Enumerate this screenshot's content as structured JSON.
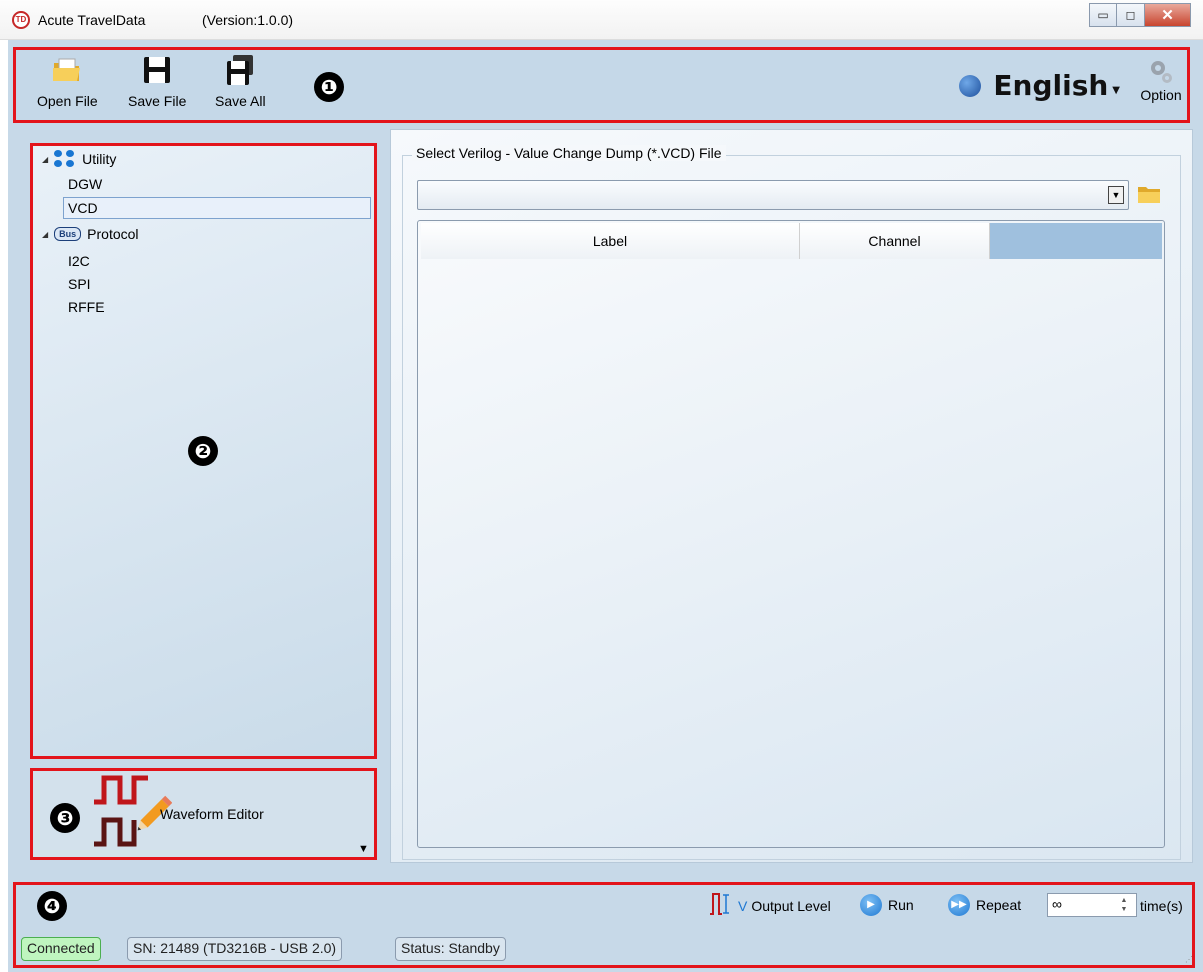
{
  "window": {
    "app_icon": "TD",
    "title": "Acute TravelData",
    "version": "(Version:1.0.0)",
    "minimize": "▭",
    "maximize": "◻",
    "close": "✕"
  },
  "toolbar": {
    "open_file": "Open File",
    "save_file": "Save File",
    "save_all": "Save All",
    "language": "English",
    "option": "Option"
  },
  "markers": [
    "❶",
    "❷",
    "❸",
    "❹"
  ],
  "sidebar": {
    "groups": [
      {
        "label": "Utility",
        "items": [
          "DGW",
          "VCD"
        ]
      },
      {
        "label": "Protocol",
        "icon_text": "Bus",
        "items": [
          "I2C",
          "SPI",
          "RFFE"
        ]
      }
    ],
    "selected": "VCD"
  },
  "waveform_editor": {
    "label": "Waveform Editor"
  },
  "vcd": {
    "group_title": "Select Verilog - Value Change Dump  (*.VCD) File",
    "file_value": "",
    "columns": [
      "Label",
      "Channel"
    ]
  },
  "controls": {
    "output_level": "Output Level",
    "run": "Run",
    "repeat": "Repeat",
    "repeat_value": "∞",
    "times": "time(s)"
  },
  "status": {
    "connected": "Connected",
    "serial": "SN: 21489 (TD3216B - USB 2.0)",
    "state": "Status: Standby"
  },
  "colors": {
    "highlight_box": "#e3141b",
    "panel_bg": "#c7d9e8",
    "connected_bg": "#bff5bf",
    "grid_header_accent": "#9fc0de"
  },
  "icons": {
    "open_file": "folder-open-icon",
    "save_file": "floppy-disk-icon",
    "save_all": "floppy-stack-icon",
    "language": "globe-icon",
    "option": "gear-icon",
    "utility": "utility-dots-icon",
    "protocol": "bus-icon",
    "waveform": "waveform-pencil-icon",
    "browse": "folder-icon",
    "output_level": "pulse-level-icon",
    "run": "play-icon",
    "repeat": "fast-forward-icon"
  }
}
